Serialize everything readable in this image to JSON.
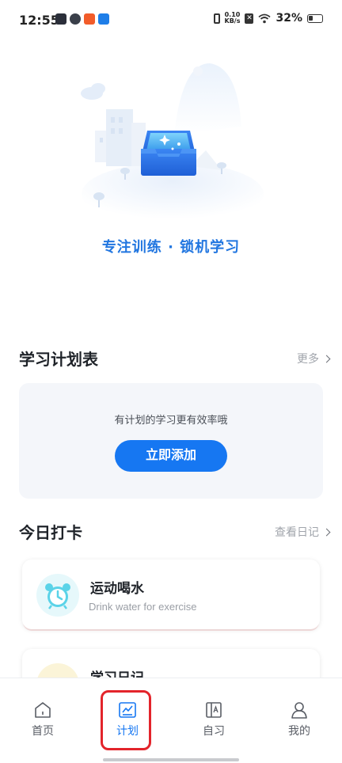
{
  "status_bar": {
    "time": "12:55",
    "net_speed_top": "0.10",
    "net_speed_bottom": "KB/s",
    "battery": "32%"
  },
  "hero": {
    "title": "专注训练 · 锁机学习"
  },
  "plan_section": {
    "title": "学习计划表",
    "more": "更多",
    "hint": "有计划的学习更有效率哦",
    "add_button": "立即添加"
  },
  "checkin_section": {
    "title": "今日打卡",
    "more": "查看日记",
    "items": [
      {
        "name": "运动喝水",
        "subtitle": "Drink water for exercise",
        "icon": "alarm-clock-icon"
      },
      {
        "name": "学习日记",
        "subtitle": "",
        "icon": "note-icon"
      }
    ]
  },
  "tabbar": {
    "tabs": [
      {
        "label": "首页",
        "icon": "home-icon"
      },
      {
        "label": "计划",
        "icon": "chart-icon",
        "active": true
      },
      {
        "label": "自习",
        "icon": "book-icon"
      },
      {
        "label": "我的",
        "icon": "person-icon"
      }
    ]
  },
  "colors": {
    "accent": "#1677f2",
    "hero_title": "#2176e0",
    "highlight_box": "#e3242b"
  }
}
